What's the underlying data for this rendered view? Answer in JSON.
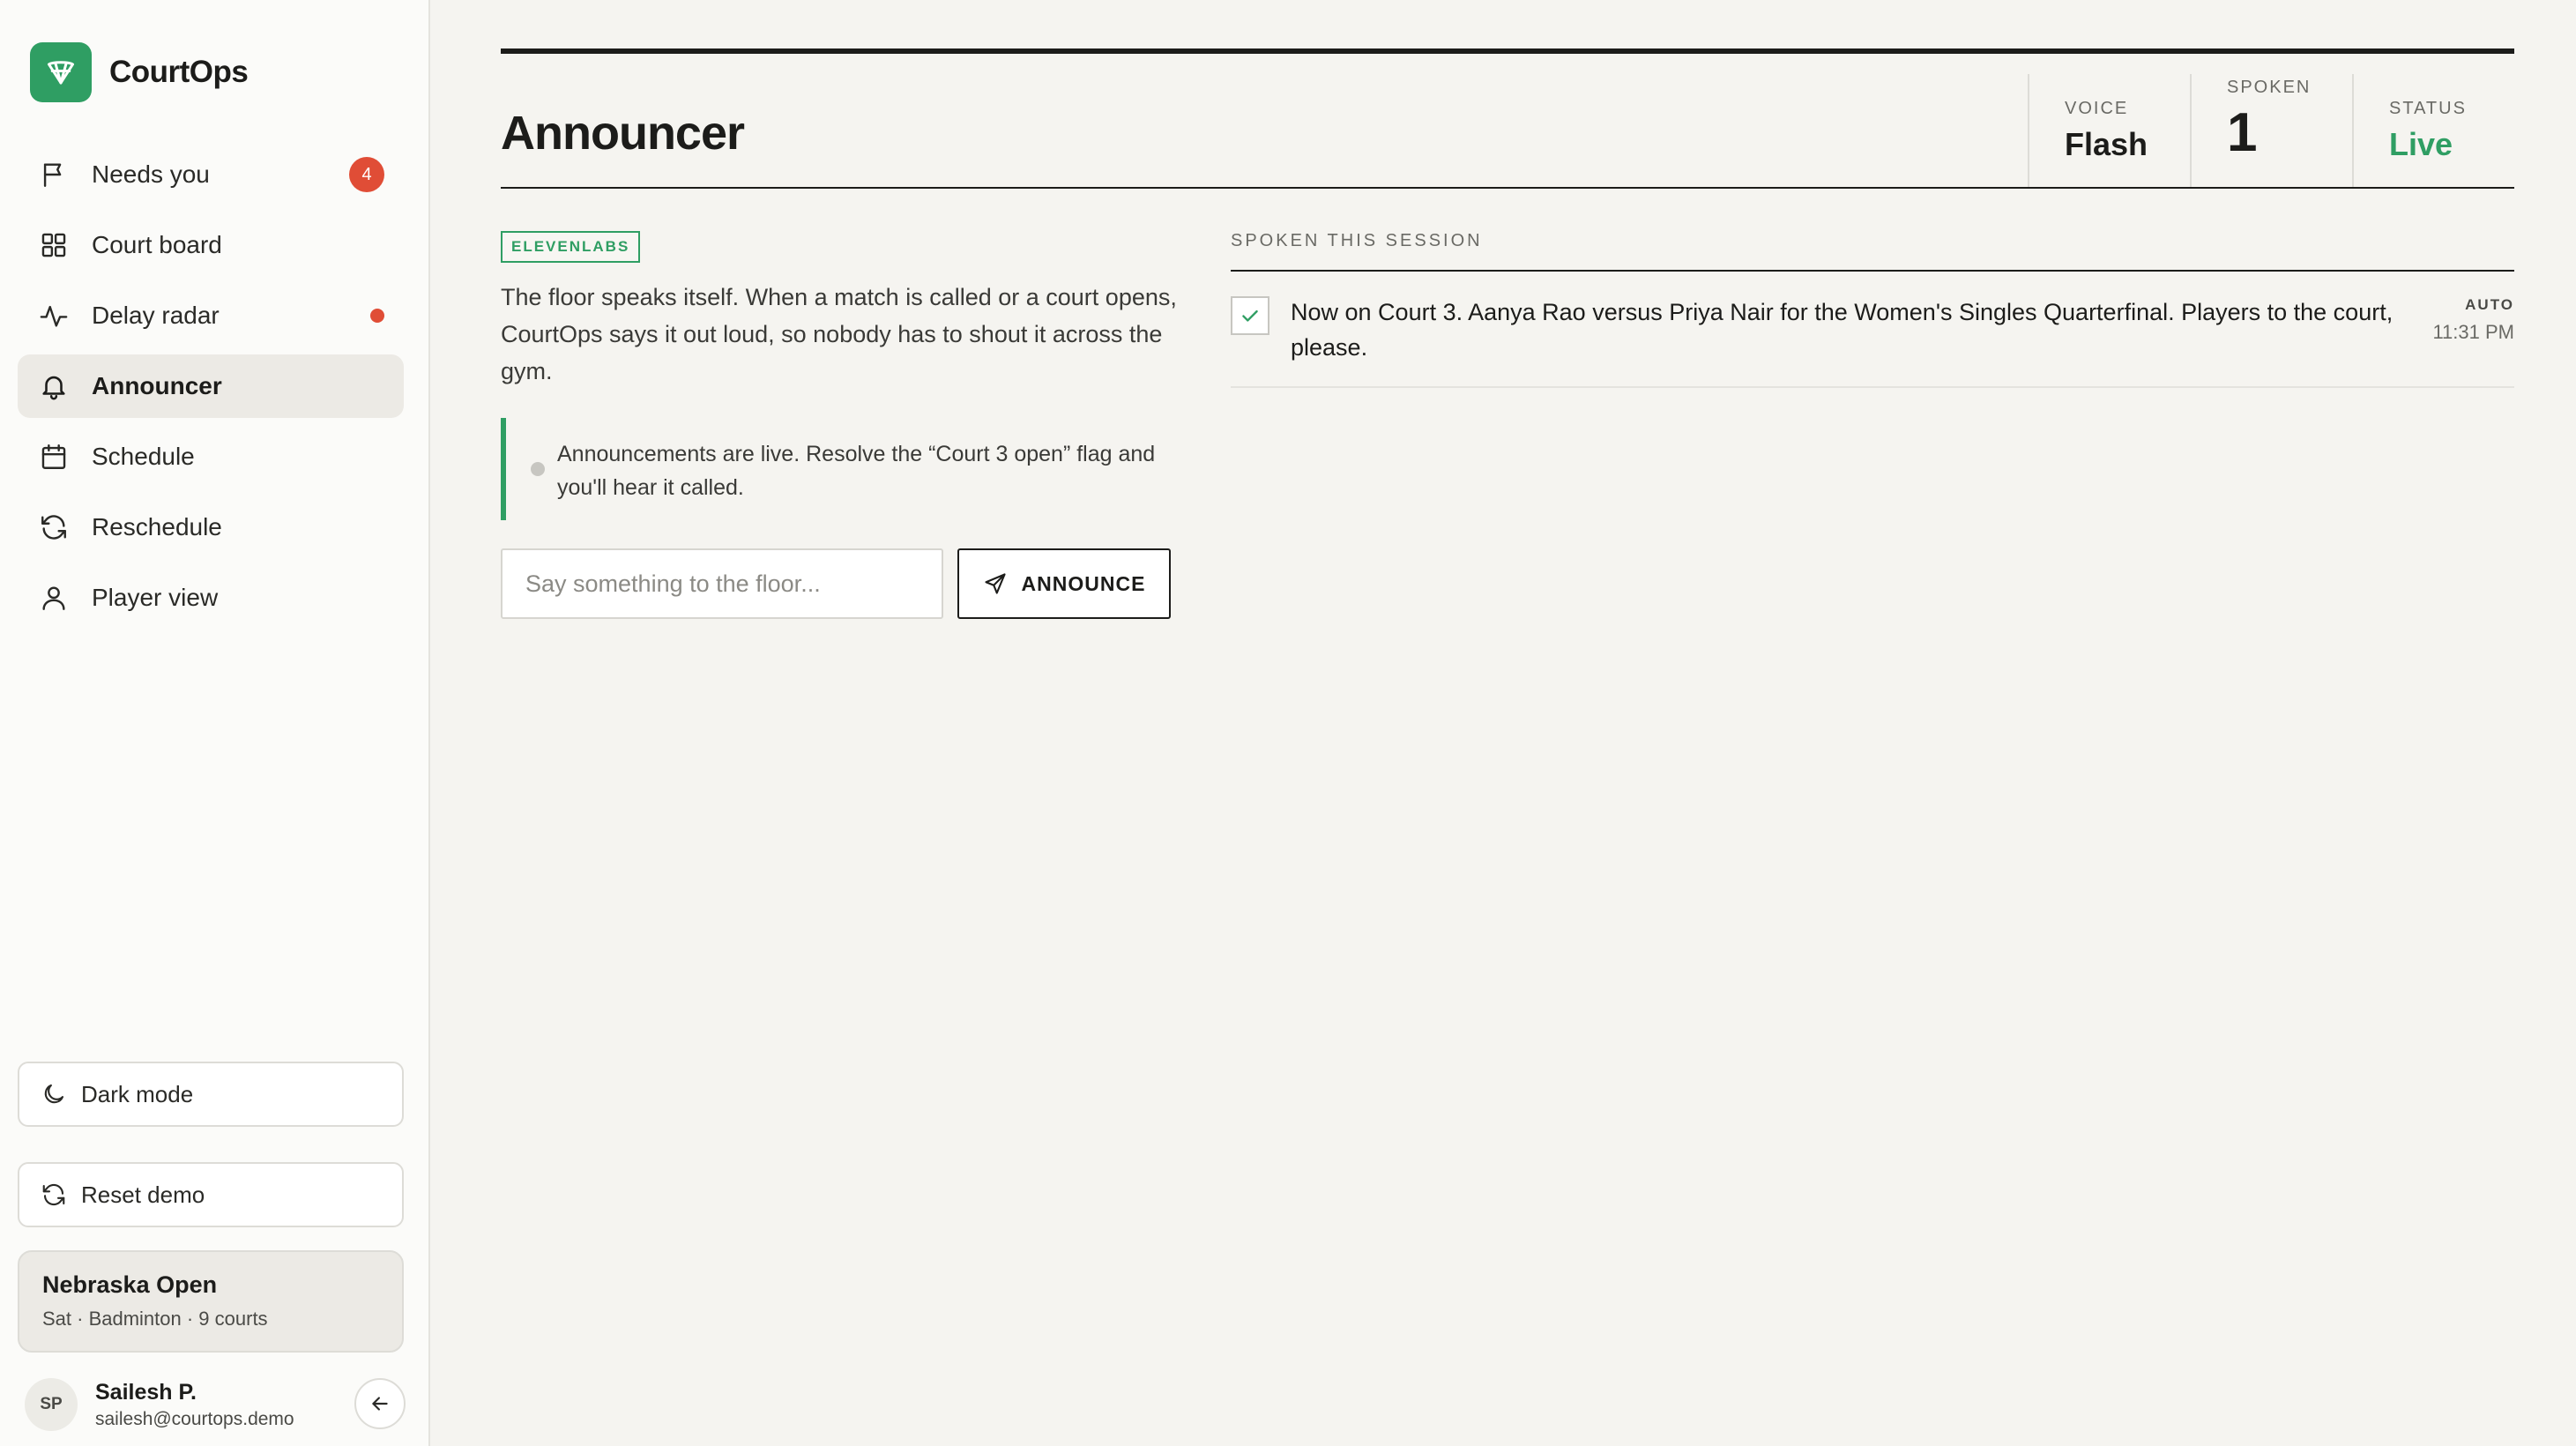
{
  "brand": {
    "name": "CourtOps"
  },
  "sidebar": {
    "items": [
      {
        "label": "Needs you",
        "badge": "4",
        "icon": "flag-icon"
      },
      {
        "label": "Court board",
        "icon": "grid-icon"
      },
      {
        "label": "Delay radar",
        "icon": "pulse-icon",
        "indicator": "red-dot"
      },
      {
        "label": "Announcer",
        "icon": "bell-icon",
        "active": true
      },
      {
        "label": "Schedule",
        "icon": "calendar-icon"
      },
      {
        "label": "Reschedule",
        "icon": "refresh-icon"
      },
      {
        "label": "Player view",
        "icon": "user-icon"
      }
    ],
    "dark_mode_label": "Dark mode",
    "reset_label": "Reset demo",
    "event": {
      "name": "Nebraska Open",
      "meta": "Sat · Badminton · 9 courts"
    },
    "user": {
      "initials": "SP",
      "name": "Sailesh P.",
      "email": "sailesh@courtops.demo"
    }
  },
  "header": {
    "title": "Announcer",
    "stats": {
      "voice": {
        "label": "VOICE",
        "value": "Flash"
      },
      "spoken": {
        "label": "SPOKEN",
        "value": "1"
      },
      "status": {
        "label": "STATUS",
        "value": "Live"
      }
    }
  },
  "main": {
    "tag": "ELEVENLABS",
    "intro": "The floor speaks itself. When a match is called or a court opens, CourtOps says it out loud, so nobody has to shout it across the gym.",
    "notice": "Announcements are live. Resolve the “Court 3 open” flag and you'll hear it called.",
    "input_placeholder": "Say something to the floor...",
    "announce_label": "ANNOUNCE"
  },
  "log": {
    "title": "SPOKEN THIS SESSION",
    "items": [
      {
        "text": "Now on Court 3. Aanya Rao versus Priya Nair for the Women's Singles Quarterfinal. Players to the court, please.",
        "source": "AUTO",
        "time": "11:31 PM"
      }
    ]
  },
  "colors": {
    "accent": "#2f9e63",
    "alert": "#e04d36",
    "background": "#f5f4f0",
    "ink": "#1c1c1a"
  }
}
